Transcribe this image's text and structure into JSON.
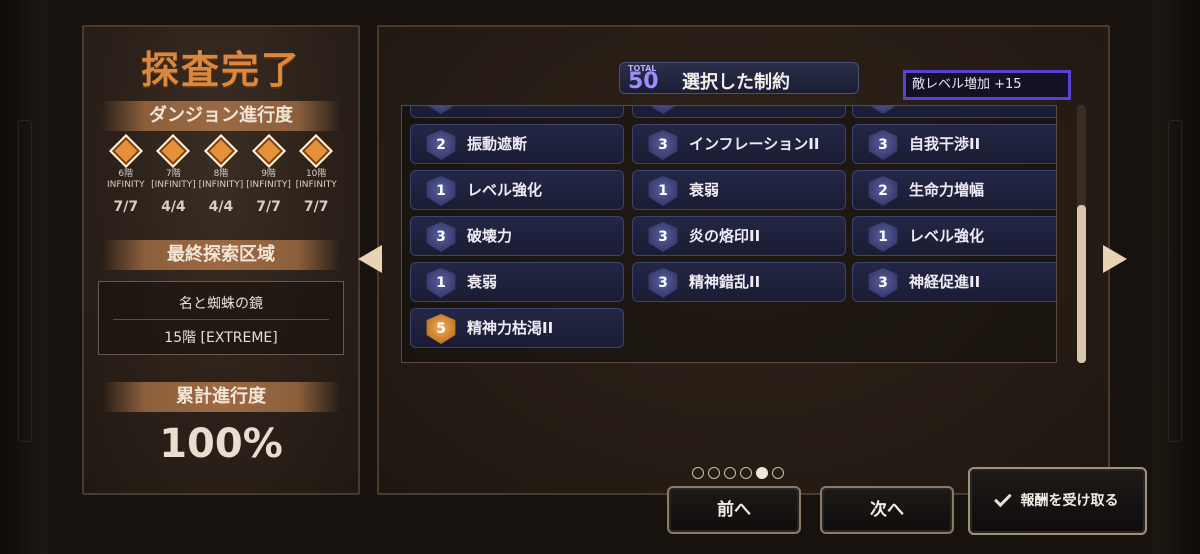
{
  "left": {
    "title": "探査完了",
    "dungeon_progress_label": "ダンジョン進行度",
    "floors": [
      {
        "name": "6階",
        "difficulty": "INFINITY",
        "progress": "7/7"
      },
      {
        "name": "7階",
        "difficulty": "[INFINITY]",
        "progress": "4/4"
      },
      {
        "name": "8階",
        "difficulty": "[INFINITY]",
        "progress": "4/4"
      },
      {
        "name": "9階",
        "difficulty": "[INFINITY]",
        "progress": "7/7"
      },
      {
        "name": "10階",
        "difficulty": "[INFINITY",
        "progress": "7/7"
      }
    ],
    "final_area_label": "最終探索区域",
    "area_name": "名と蜘蛛の鏡",
    "area_floor": "15階 [EXTREME]",
    "total_progress_label": "累計進行度",
    "total_progress": "100%"
  },
  "main": {
    "total_label": "TOTAL",
    "total_value": "50",
    "header_title": "選択した制約",
    "enemy_level": "敵レベル増加 +15",
    "constraints": [
      {
        "level": "",
        "name": "",
        "badge": "silver"
      },
      {
        "level": "",
        "name": "",
        "badge": "silver"
      },
      {
        "level": "",
        "name": "",
        "badge": "silver"
      },
      {
        "level": "2",
        "name": "振動遮断",
        "badge": "blue"
      },
      {
        "level": "3",
        "name": "インフレーションII",
        "badge": "silver"
      },
      {
        "level": "3",
        "name": "自我干渉II",
        "badge": "silver"
      },
      {
        "level": "1",
        "name": "レベル強化",
        "badge": "blue"
      },
      {
        "level": "1",
        "name": "衰弱",
        "badge": "blue"
      },
      {
        "level": "2",
        "name": "生命力増幅",
        "badge": "blue"
      },
      {
        "level": "3",
        "name": "破壊力",
        "badge": "silver"
      },
      {
        "level": "3",
        "name": "炎の烙印II",
        "badge": "silver"
      },
      {
        "level": "1",
        "name": "レベル強化",
        "badge": "blue"
      },
      {
        "level": "1",
        "name": "衰弱",
        "badge": "blue"
      },
      {
        "level": "3",
        "name": "精神錯乱II",
        "badge": "silver"
      },
      {
        "level": "3",
        "name": "神経促進II",
        "badge": "silver"
      },
      {
        "level": "5",
        "name": "精神力枯渇II",
        "badge": "gold"
      }
    ],
    "pagination": {
      "pages": 6,
      "current": 5
    }
  },
  "buttons": {
    "prev": "前へ",
    "next": "次へ",
    "reward": "報酬を受け取る"
  }
}
